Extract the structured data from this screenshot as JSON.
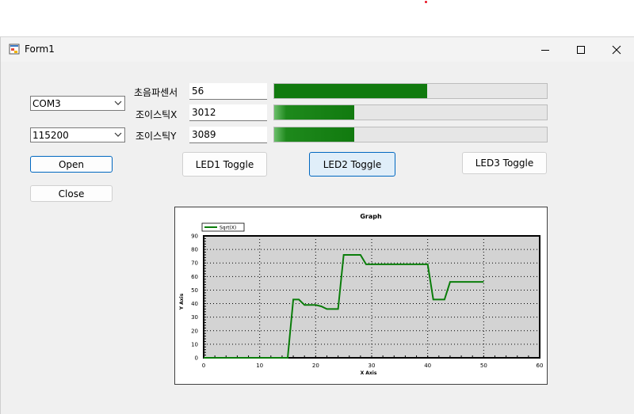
{
  "window": {
    "title": "Form1"
  },
  "serial": {
    "port": "COM3",
    "baud": "115200",
    "open_label": "Open",
    "close_label": "Close"
  },
  "sensors": [
    {
      "label": "초음파센서",
      "value": "56",
      "level": 0.56
    },
    {
      "label": "조이스틱X",
      "value": "3012",
      "level": 0.295
    },
    {
      "label": "조이스틱Y",
      "value": "3089",
      "level": 0.295
    }
  ],
  "leds": {
    "led1": "LED1 Toggle",
    "led2": "LED2 Toggle",
    "led3": "LED3 Toggle"
  },
  "colors": {
    "progress": "#117a0f",
    "series": "#0a7d0a",
    "plot_bg": "#d3d3d3"
  },
  "chart_data": {
    "type": "line",
    "title": "Graph",
    "xlabel": "X Axis",
    "ylabel": "Y Axis",
    "xlim": [
      0,
      60
    ],
    "ylim": [
      0,
      90
    ],
    "xticks": [
      0,
      10,
      20,
      30,
      40,
      50,
      60
    ],
    "yticks": [
      0,
      10,
      20,
      30,
      40,
      50,
      60,
      70,
      80,
      90
    ],
    "grid": true,
    "legend": "top-left",
    "series": [
      {
        "name": "Sqrt(X)",
        "x": [
          0,
          15,
          16,
          17,
          18,
          20,
          21,
          22,
          24,
          25,
          28,
          29,
          40,
          41,
          43,
          44,
          50
        ],
        "y": [
          0,
          0,
          43,
          43,
          39,
          39,
          38,
          36,
          36,
          76,
          76,
          69,
          69,
          43,
          43,
          56,
          56
        ]
      }
    ]
  }
}
